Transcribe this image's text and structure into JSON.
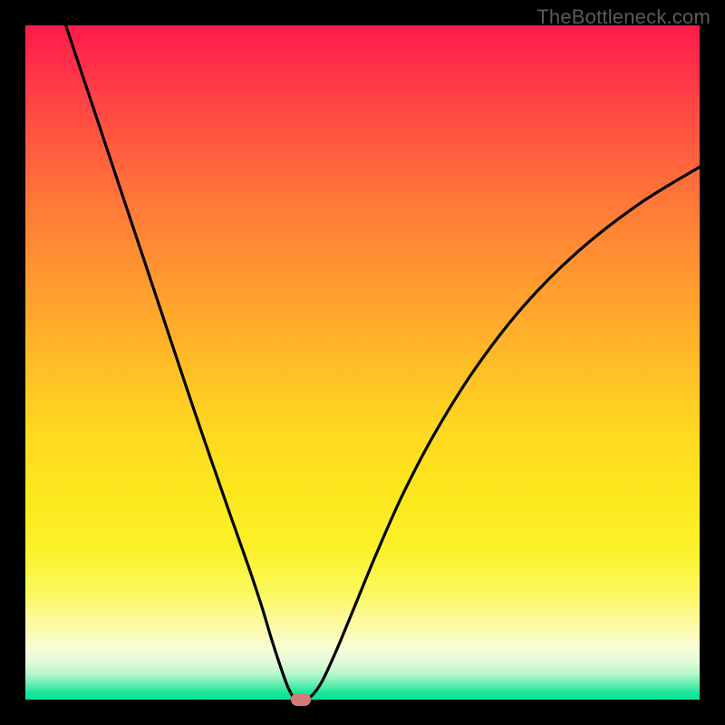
{
  "watermark": "TheBottleneck.com",
  "chart_data": {
    "type": "line",
    "title": "",
    "xlabel": "",
    "ylabel": "",
    "x_range": [
      0,
      100
    ],
    "y_range": [
      0,
      100
    ],
    "series": [
      {
        "name": "bottleneck-curve",
        "points": [
          {
            "x": 6,
            "y": 100
          },
          {
            "x": 10,
            "y": 88
          },
          {
            "x": 15,
            "y": 73
          },
          {
            "x": 20,
            "y": 58
          },
          {
            "x": 25,
            "y": 43
          },
          {
            "x": 30,
            "y": 28.5
          },
          {
            "x": 33,
            "y": 20
          },
          {
            "x": 35,
            "y": 14
          },
          {
            "x": 36.5,
            "y": 9
          },
          {
            "x": 37.8,
            "y": 5
          },
          {
            "x": 38.8,
            "y": 2.2
          },
          {
            "x": 39.6,
            "y": 0.6
          },
          {
            "x": 40.5,
            "y": 0
          },
          {
            "x": 41.4,
            "y": 0
          },
          {
            "x": 42.5,
            "y": 0.6
          },
          {
            "x": 44,
            "y": 2.7
          },
          {
            "x": 46,
            "y": 7
          },
          {
            "x": 48.5,
            "y": 13
          },
          {
            "x": 52,
            "y": 21.5
          },
          {
            "x": 56,
            "y": 30.5
          },
          {
            "x": 61,
            "y": 40
          },
          {
            "x": 67,
            "y": 49.5
          },
          {
            "x": 74,
            "y": 58.5
          },
          {
            "x": 82,
            "y": 66.5
          },
          {
            "x": 91,
            "y": 73.5
          },
          {
            "x": 100,
            "y": 79
          }
        ]
      }
    ],
    "marker": {
      "x": 40.8,
      "y": 0
    },
    "colors": {
      "curve": "#000000",
      "marker": "#d47b7a"
    }
  }
}
